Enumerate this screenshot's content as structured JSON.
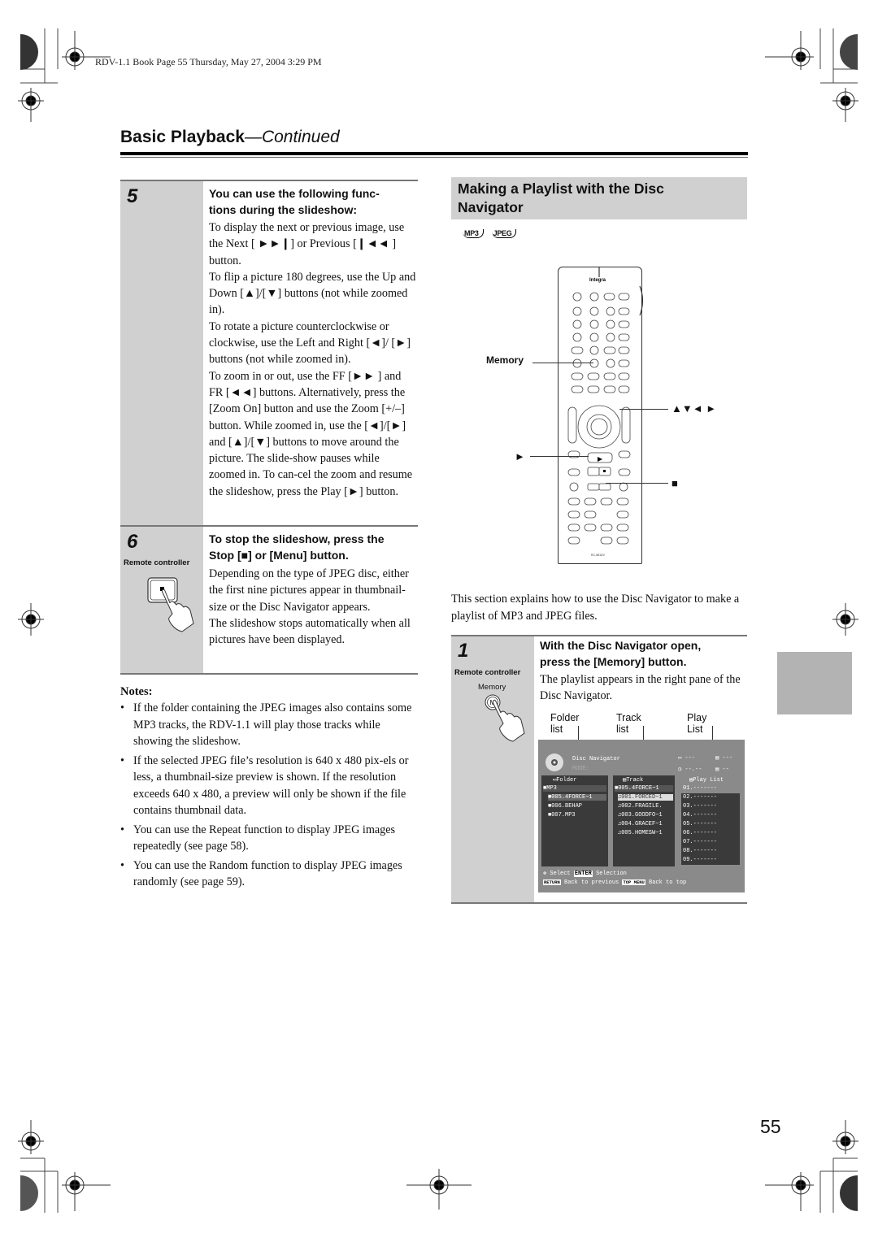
{
  "print_header": "RDV-1.1 Book Page 55 Thursday, May 27, 2004 3:29 PM",
  "section": {
    "title": "Basic Playback",
    "subtitle": "—Continued"
  },
  "left_column": {
    "step5": {
      "number": "5",
      "heading": "You can use the following func-tions during the slideshow:",
      "heading_line1": "You can use the following func-",
      "heading_line2": "tions during the slideshow:",
      "paragraphs": [
        "To display the next or previous image, use the Next [ ►►❙] or Previous [❙◄◄ ] button.",
        "To flip a picture 180 degrees, use the Up and Down [▲]/[▼] buttons (not while zoomed in).",
        "To rotate a picture counterclockwise or clockwise, use the Left and Right [◄]/ [►] buttons (not while zoomed in).",
        "To zoom in or out, use the FF [►► ] and FR [◄◄] buttons. Alternatively, press the [Zoom On] button and use the Zoom [+/–] button. While zoomed in, use the [◄]/[►] and [▲]/[▼] buttons to move around the picture. The slide-show pauses while zoomed in. To can-cel the zoom and resume the slideshow, press the Play [►] button."
      ]
    },
    "step6": {
      "number": "6",
      "remote_label": "Remote controller",
      "heading_line1": "To stop the slideshow, press the",
      "heading_line2": "Stop [■] or [Menu] button.",
      "paragraphs": [
        "Depending on the type of JPEG disc, either the first nine pictures appear in thumbnail-size or the Disc Navigator appears.",
        "The slideshow stops automatically when all pictures have been displayed."
      ]
    },
    "notes": {
      "title": "Notes:",
      "items": [
        "If the folder containing the JPEG images also contains some MP3 tracks, the RDV-1.1 will play those tracks while showing the slideshow.",
        "If the selected JPEG file’s resolution is 640 x 480 pix-els or less, a thumbnail-size preview is shown. If the resolution exceeds 640 x 480, a preview will only be shown if the file contains thumbnail data.",
        "You can use the Repeat function to display JPEG images repeatedly (see page 58).",
        "You can use the Random function to display JPEG images randomly (see page 59)."
      ]
    }
  },
  "right_column": {
    "heading": "Making a Playlist with the Disc Navigator",
    "heading_line1": "Making a Playlist with the Disc",
    "heading_line2": "Navigator",
    "formats": [
      "MP3",
      "JPEG"
    ],
    "remote": {
      "brand": "Integra",
      "model": "RC-581DV",
      "callouts": {
        "memory": "Memory",
        "arrows": "▲▼◄ ►",
        "play": "►",
        "stop": "■"
      }
    },
    "intro": "This section explains how to use the Disc Navigator to make a playlist of MP3 and JPEG files.",
    "step1": {
      "number": "1",
      "remote_label": "Remote controller",
      "button_label": "Memory",
      "button_glyph": "M",
      "heading_line1": "With the Disc Navigator open,",
      "heading_line2": "press the [Memory] button.",
      "body": "The playlist appears in the right pane of the Disc Navigator.",
      "column_labels": [
        "Folder list",
        "Track list",
        "Play List"
      ]
    },
    "disc_navigator": {
      "title": "Disc Navigator",
      "mode_label": "MODE:",
      "status": {
        "folder_count": "---",
        "track_count": "---",
        "time": "--.--",
        "playlist_count": "--"
      },
      "folder_pane": {
        "header": "Folder",
        "items": [
          "MP3",
          "005.4FORCE~1",
          "006.BEHAP",
          "007.MP3"
        ]
      },
      "track_pane": {
        "header": "Track",
        "folder": "005.4FORCE~1",
        "items": [
          "001.FORCED~1",
          "002.FRAGILE.",
          "003.GOODFO~1",
          "004.GRACEF~1",
          "005.HOMESW~1"
        ]
      },
      "playlist_pane": {
        "header": "Play List",
        "items": [
          "01.-------",
          "02.-------",
          "03.-------",
          "04.-------",
          "05.-------",
          "06.-------",
          "07.-------",
          "08.-------",
          "09.-------"
        ]
      },
      "footer": {
        "select_label": "Select",
        "enter_key": "ENTER",
        "enter_label": "Selection",
        "return_key": "RETURN",
        "return_label": "Back to previous",
        "topmenu_key": "TOP MENU",
        "topmenu_label": "Back to top"
      }
    }
  },
  "page_number": "55"
}
